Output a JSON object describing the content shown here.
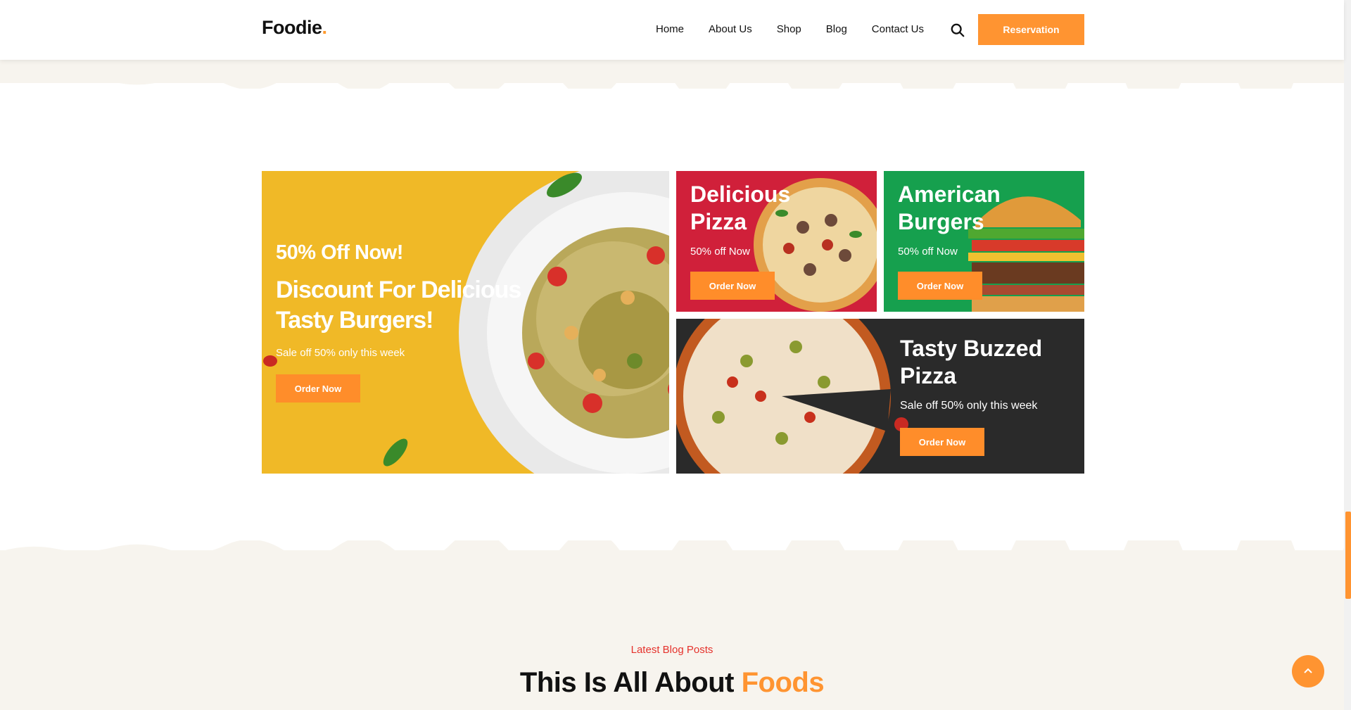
{
  "header": {
    "logo": "Foodie",
    "logo_dot": ".",
    "nav": [
      "Home",
      "About Us",
      "Shop",
      "Blog",
      "Contact Us"
    ],
    "search_icon": "search-icon",
    "reservation_label": "Reservation"
  },
  "banners": {
    "main": {
      "offer": "50% Off Now!",
      "title_line1": "Discount For Delicious",
      "title_line2": "Tasty Burgers!",
      "subtitle": "Sale off 50% only this week",
      "button": "Order Now"
    },
    "pizza": {
      "title_line1": "Delicious",
      "title_line2": "Pizza",
      "subtitle": "50% off Now",
      "button": "Order Now"
    },
    "burger": {
      "title_line1": "American",
      "title_line2": "Burgers",
      "subtitle": "50% off Now",
      "button": "Order Now"
    },
    "tasty": {
      "title_line1": "Tasty Buzzed",
      "title_line2": "Pizza",
      "subtitle": "Sale off 50% only this week",
      "button": "Order Now"
    }
  },
  "blog_section": {
    "subtitle": "Latest Blog Posts",
    "title_main": "This Is All About ",
    "title_highlight": "Foods"
  },
  "colors": {
    "accent": "#ff9431",
    "yellow": "#f0b927",
    "red": "#d0203a",
    "green": "#16a04e",
    "dark": "#2a2a2a",
    "beige": "#f7f4ee"
  }
}
